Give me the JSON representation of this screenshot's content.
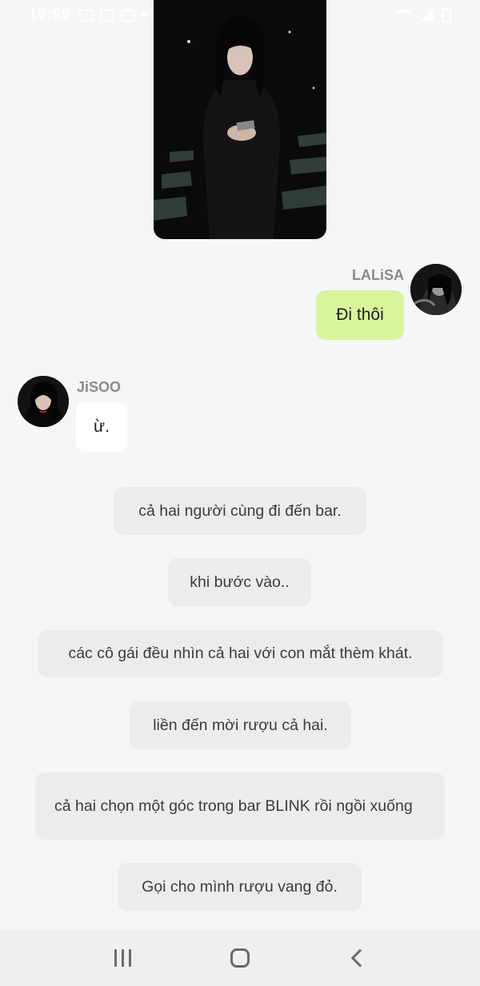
{
  "status_bar": {
    "time": "16:59",
    "icons": [
      "gallery-icon",
      "calendar-icon",
      "messenger-icon",
      "dot-icon",
      "wifi-icon",
      "signal-icon",
      "battery-icon"
    ]
  },
  "photo_message": {
    "description_icon": "photo"
  },
  "messages": [
    {
      "sender": "LALiSA",
      "text": "Đi thôi",
      "side": "right",
      "bubble_color": "#d9f59a"
    },
    {
      "sender": "JiSOO",
      "text": "ừ.",
      "side": "left",
      "bubble_color": "#ffffff"
    }
  ],
  "narrations": [
    "cả hai người cùng đi đến bar.",
    "khi bước vào..",
    "các cô gái đều nhìn cả hai với con mắt thèm khát.",
    "liền đến mời rượu cả hai.",
    "cả hai chọn một góc trong bar BLINK rồi ngồi xuống",
    "Gọi cho mình rượu vang đỏ."
  ],
  "colors": {
    "background": "#f6f6f6",
    "narration_bg": "#ececec",
    "right_bubble": "#d9f59a",
    "left_bubble": "#ffffff",
    "sender_name": "#8a8a8a"
  },
  "nav_bar": {
    "icons": [
      "recent-apps-icon",
      "home-icon",
      "back-icon"
    ]
  }
}
